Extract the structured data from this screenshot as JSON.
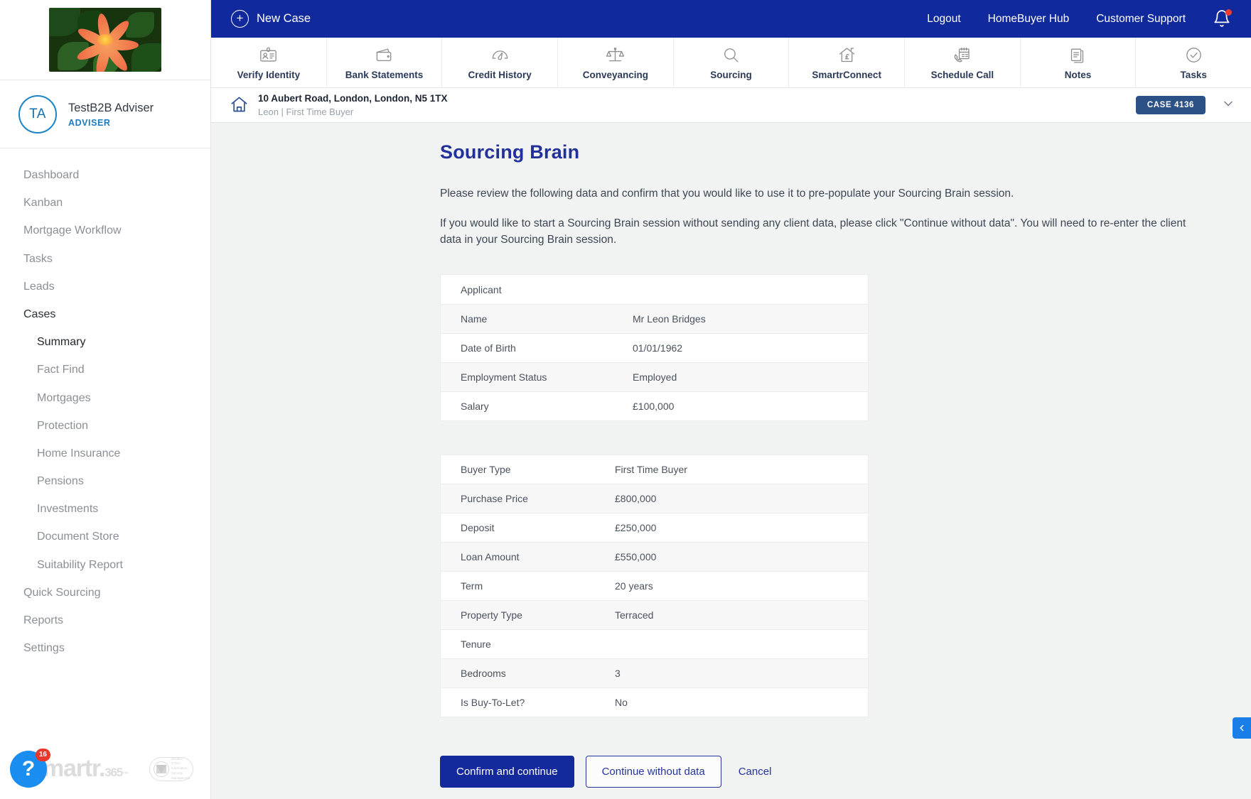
{
  "sidebar": {
    "user": {
      "initials": "TA",
      "name": "TestB2B Adviser",
      "role": "ADVISER"
    },
    "nav": [
      {
        "label": "Dashboard",
        "sub": false,
        "active": false
      },
      {
        "label": "Kanban",
        "sub": false,
        "active": false
      },
      {
        "label": "Mortgage Workflow",
        "sub": false,
        "active": false
      },
      {
        "label": "Tasks",
        "sub": false,
        "active": false
      },
      {
        "label": "Leads",
        "sub": false,
        "active": false
      },
      {
        "label": "Cases",
        "sub": false,
        "active": true
      },
      {
        "label": "Summary",
        "sub": true,
        "active": true
      },
      {
        "label": "Fact Find",
        "sub": true,
        "active": false
      },
      {
        "label": "Mortgages",
        "sub": true,
        "active": false
      },
      {
        "label": "Protection",
        "sub": true,
        "active": false
      },
      {
        "label": "Home Insurance",
        "sub": true,
        "active": false
      },
      {
        "label": "Pensions",
        "sub": true,
        "active": false
      },
      {
        "label": "Investments",
        "sub": true,
        "active": false
      },
      {
        "label": "Document Store",
        "sub": true,
        "active": false
      },
      {
        "label": "Suitability Report",
        "sub": true,
        "active": false
      },
      {
        "label": "Quick Sourcing",
        "sub": false,
        "active": false
      },
      {
        "label": "Reports",
        "sub": false,
        "active": false
      },
      {
        "label": "Settings",
        "sub": false,
        "active": false
      }
    ],
    "footer": {
      "help_badge_count": "16",
      "logo_text": "martr.",
      "logo_sup": "365",
      "logo_tm": "™",
      "iso_line1": "ISO/IEC",
      "iso_line2": "27001",
      "iso_line3": "Information Security",
      "iso_line4": "Management"
    }
  },
  "topbar": {
    "new_case_label": "New Case",
    "links": [
      "Logout",
      "HomeBuyer Hub",
      "Customer Support"
    ]
  },
  "tools": [
    {
      "label": "Verify Identity",
      "icon": "id-card-icon"
    },
    {
      "label": "Bank Statements",
      "icon": "wallet-icon"
    },
    {
      "label": "Credit History",
      "icon": "gauge-icon"
    },
    {
      "label": "Conveyancing",
      "icon": "scales-icon"
    },
    {
      "label": "Sourcing",
      "icon": "magnifier-icon"
    },
    {
      "label": "SmartrConnect",
      "icon": "house-pound-icon"
    },
    {
      "label": "Schedule Call",
      "icon": "calendar-phone-icon"
    },
    {
      "label": "Notes",
      "icon": "documents-icon"
    },
    {
      "label": "Tasks",
      "icon": "check-circle-icon"
    }
  ],
  "casebar": {
    "address": "10 Aubert Road, London, London, N5 1TX",
    "subtitle": "Leon | First Time Buyer",
    "case_pill": "CASE 4136"
  },
  "page": {
    "title": "Sourcing Brain",
    "paragraph1": "Please review the following data and confirm that you would like to use it to pre-populate your Sourcing Brain session.",
    "paragraph2": "If you would like to start a Sourcing Brain session without sending any client data, please click \"Continue without data\". You will need to re-enter the client data in your Sourcing Brain session."
  },
  "applicant_table": {
    "header": "Applicant",
    "rows": [
      {
        "key": "Name",
        "value": "Mr Leon Bridges"
      },
      {
        "key": "Date of Birth",
        "value": "01/01/1962"
      },
      {
        "key": "Employment Status",
        "value": "Employed"
      },
      {
        "key": "Salary",
        "value": "£100,000"
      }
    ]
  },
  "mortgage_table": {
    "rows": [
      {
        "key": "Buyer Type",
        "value": "First Time Buyer"
      },
      {
        "key": "Purchase Price",
        "value": "£800,000"
      },
      {
        "key": "Deposit",
        "value": "£250,000"
      },
      {
        "key": "Loan Amount",
        "value": "£550,000"
      },
      {
        "key": "Term",
        "value": "20 years"
      },
      {
        "key": "Property Type",
        "value": "Terraced"
      },
      {
        "key": "Tenure",
        "value": ""
      },
      {
        "key": "Bedrooms",
        "value": "3"
      },
      {
        "key": "Is Buy-To-Let?",
        "value": "No"
      }
    ]
  },
  "actions": {
    "confirm": "Confirm and continue",
    "continue_without": "Continue without data",
    "cancel": "Cancel"
  },
  "colors": {
    "brand_blue": "#102a9e",
    "accent_blue": "#1a7ee8",
    "title_blue": "#22309c",
    "pill_blue": "#2c5186",
    "alert_red": "#e8372b"
  }
}
